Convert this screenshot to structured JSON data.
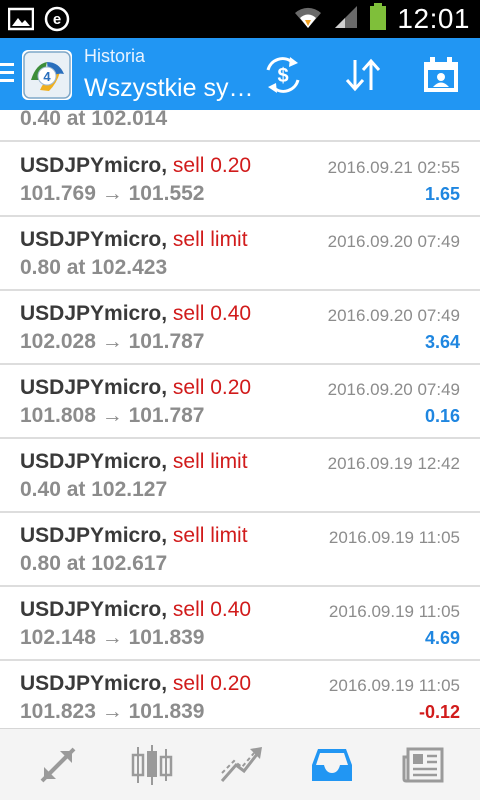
{
  "statusbar": {
    "time": "12:01"
  },
  "appbar": {
    "subtitle": "Historia",
    "title": "Wszystkie sy…"
  },
  "partial_row": {
    "price": "0.40 at 102.014"
  },
  "rows": [
    {
      "symbol": "USDJPYmicro",
      "action": "sell 0.20",
      "price": "101.769 → 101.552",
      "time": "2016.09.21 02:55",
      "profit": "1.65"
    },
    {
      "symbol": "USDJPYmicro",
      "action": "sell limit",
      "price": "0.80 at 102.423",
      "time": "2016.09.20 07:49",
      "profit": ""
    },
    {
      "symbol": "USDJPYmicro",
      "action": "sell 0.40",
      "price": "102.028 → 101.787",
      "time": "2016.09.20 07:49",
      "profit": "3.64"
    },
    {
      "symbol": "USDJPYmicro",
      "action": "sell 0.20",
      "price": "101.808 → 101.787",
      "time": "2016.09.20 07:49",
      "profit": "0.16"
    },
    {
      "symbol": "USDJPYmicro",
      "action": "sell limit",
      "price": "0.40 at 102.127",
      "time": "2016.09.19 12:42",
      "profit": ""
    },
    {
      "symbol": "USDJPYmicro",
      "action": "sell limit",
      "price": "0.80 at 102.617",
      "time": "2016.09.19 11:05",
      "profit": ""
    },
    {
      "symbol": "USDJPYmicro",
      "action": "sell 0.40",
      "price": "102.148 → 101.839",
      "time": "2016.09.19 11:05",
      "profit": "4.69"
    },
    {
      "symbol": "USDJPYmicro",
      "action": "sell 0.20",
      "price": "101.823 → 101.839",
      "time": "2016.09.19 11:05",
      "profit": "-0.12"
    }
  ],
  "colors": {
    "appbar": "#2196f3",
    "sell": "#d11b1b",
    "profit_positive": "#1f86e0",
    "profit_negative": "#d11b1b",
    "nav_active": "#2196f3",
    "nav_inactive": "#9a9a9a"
  },
  "icons": {
    "statusbar": [
      "image-icon",
      "e-app-icon",
      "wifi-icon",
      "signal-icon",
      "battery-icon"
    ],
    "appbar": [
      "menu-icon",
      "metatrader-logo",
      "currency-exchange-icon",
      "sort-icon",
      "calendar-icon"
    ],
    "bottomnav": [
      "quotes-icon",
      "chart-icon",
      "trade-icon",
      "history-icon",
      "news-icon"
    ]
  },
  "bottomnav": {
    "active": "history"
  }
}
